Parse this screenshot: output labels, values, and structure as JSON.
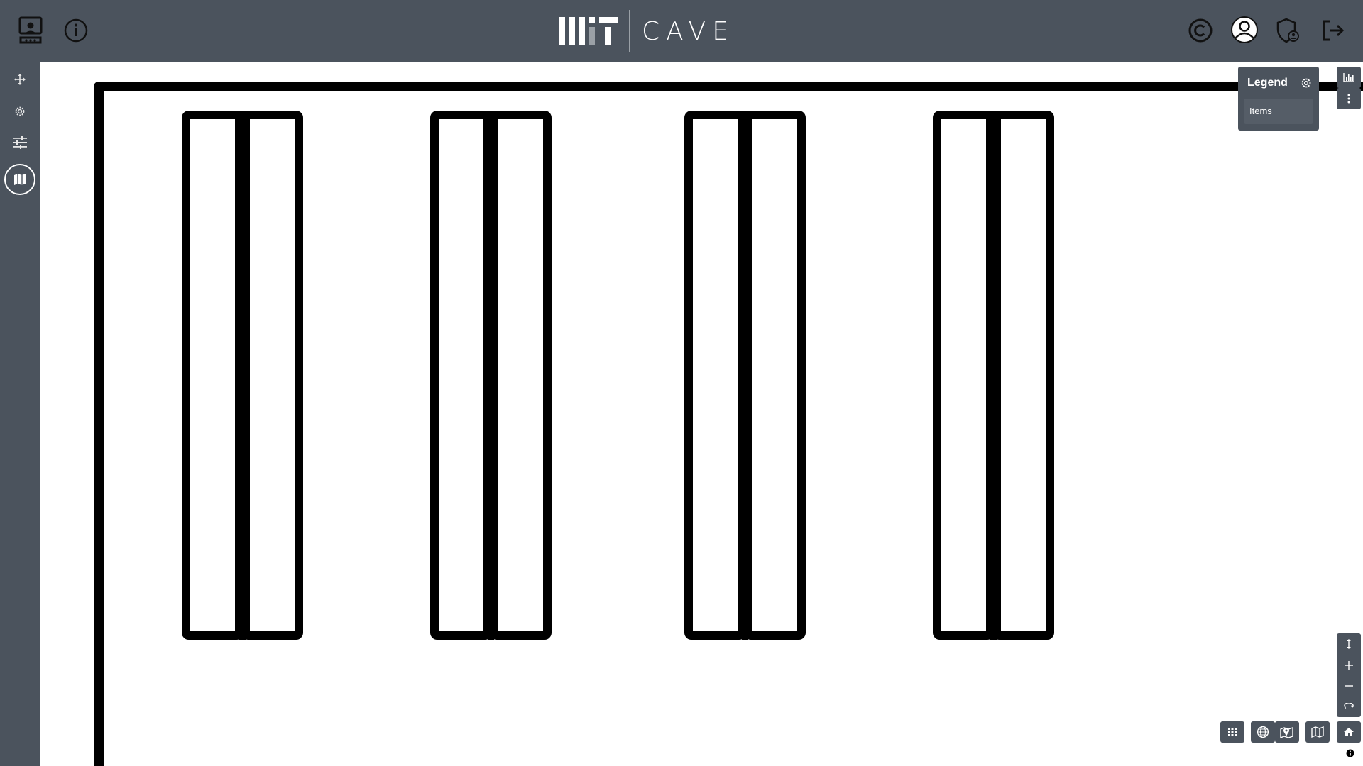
{
  "app": {
    "brand_mark": "MIT",
    "brand_name": "CAVE"
  },
  "topbar": {
    "left_icons": [
      "presentation-icon",
      "info-icon"
    ],
    "right_icons": [
      "copyright-icon",
      "user-icon",
      "shield-user-icon",
      "logout-icon"
    ]
  },
  "sidebar": {
    "items": [
      {
        "icon": "move-icon",
        "active": false
      },
      {
        "icon": "gear-icon",
        "active": false
      },
      {
        "icon": "sliders-icon",
        "active": false
      },
      {
        "icon": "map-icon",
        "active": true
      }
    ]
  },
  "legend": {
    "title": "Legend",
    "items": [
      "Items"
    ]
  },
  "map_controls": {
    "top_right": [
      "chart-icon",
      "more-vertical-icon"
    ],
    "zoom": [
      "pitch-icon",
      "zoom-in-icon",
      "zoom-out-icon",
      "rotate-icon"
    ],
    "bottom": [
      "grid-icon",
      "globe-icon",
      "map-pin-icon",
      "map-icon",
      "home-icon"
    ]
  },
  "colors": {
    "bar": "#4b535d",
    "map_bg": "#ffffff",
    "lines": "#000000"
  }
}
